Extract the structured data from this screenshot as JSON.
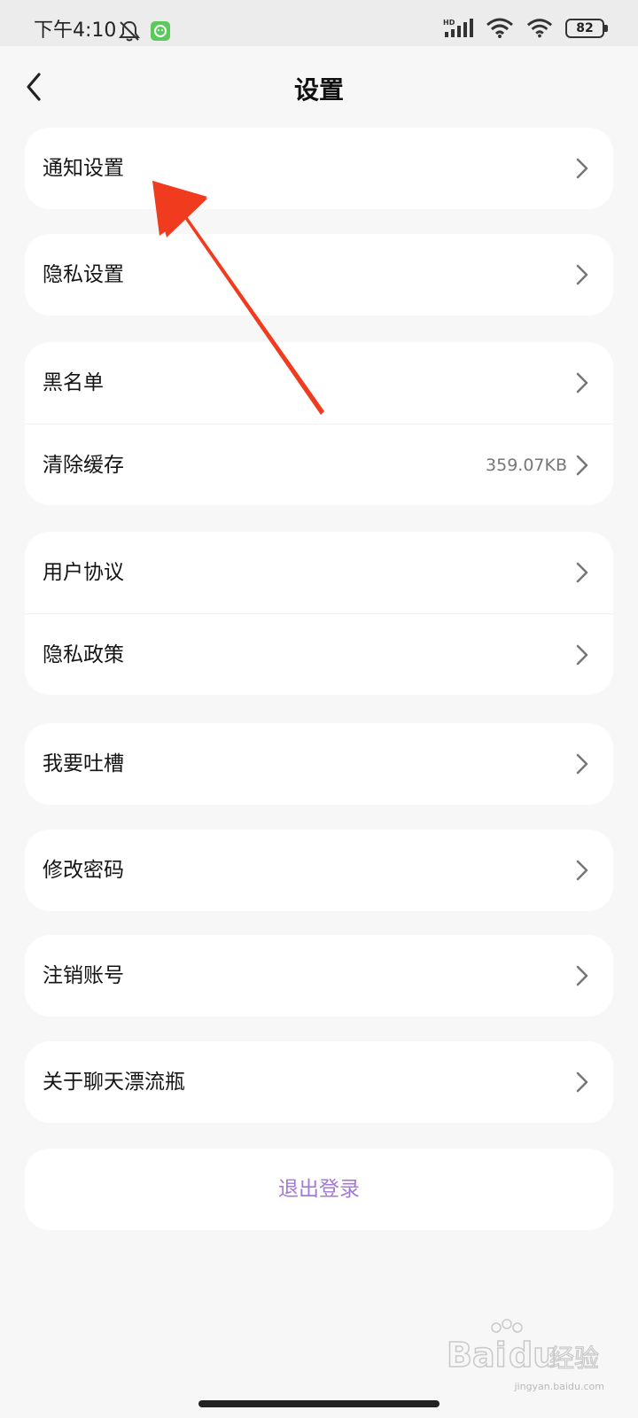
{
  "status_bar": {
    "time": "下午4:10",
    "battery": "82",
    "network_badge": "HD"
  },
  "header": {
    "title": "设置"
  },
  "groups": [
    {
      "items": [
        {
          "label": "通知设置"
        }
      ]
    },
    {
      "items": [
        {
          "label": "隐私设置"
        }
      ]
    },
    {
      "items": [
        {
          "label": "黑名单"
        },
        {
          "label": "清除缓存",
          "value": "359.07KB"
        }
      ]
    },
    {
      "items": [
        {
          "label": "用户协议"
        },
        {
          "label": "隐私政策"
        }
      ]
    },
    {
      "items": [
        {
          "label": "我要吐槽"
        }
      ]
    },
    {
      "items": [
        {
          "label": "修改密码"
        }
      ]
    },
    {
      "items": [
        {
          "label": "注销账号"
        }
      ]
    },
    {
      "items": [
        {
          "label": "关于聊天漂流瓶"
        }
      ]
    }
  ],
  "logout": {
    "label": "退出登录"
  },
  "watermark": {
    "brand": "Bai",
    "brand_du": "du",
    "suffix": "经验",
    "url": "jingyan.baidu.com"
  },
  "colors": {
    "accent_logout": "#a47ad6",
    "annotation_arrow": "#f13b1f",
    "background": "#f7f7f7",
    "card": "#ffffff"
  }
}
